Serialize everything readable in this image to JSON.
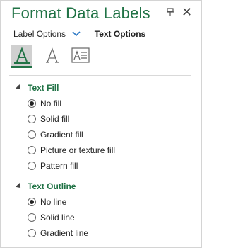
{
  "pane": {
    "title": "Format Data Labels",
    "pin_icon": "pin-icon",
    "close_icon": "close-icon",
    "close_glyph": "✕"
  },
  "tabs": {
    "label_options": "Label Options",
    "text_options": "Text Options"
  },
  "icons": [
    {
      "name": "text-fill-outline-icon",
      "selected": true
    },
    {
      "name": "text-effects-icon",
      "selected": false
    },
    {
      "name": "textbox-icon",
      "selected": false
    }
  ],
  "text_fill": {
    "heading": "Text Fill",
    "options": [
      {
        "label": "No fill",
        "checked": true
      },
      {
        "label": "Solid fill",
        "checked": false
      },
      {
        "label": "Gradient fill",
        "checked": false
      },
      {
        "label": "Picture or texture fill",
        "checked": false
      },
      {
        "label": "Pattern fill",
        "checked": false
      }
    ]
  },
  "text_outline": {
    "heading": "Text Outline",
    "options": [
      {
        "label": "No line",
        "checked": true
      },
      {
        "label": "Solid line",
        "checked": false
      },
      {
        "label": "Gradient line",
        "checked": false
      }
    ]
  },
  "colors": {
    "accent": "#217346",
    "selected_icon_bg": "#d0d0d0"
  }
}
